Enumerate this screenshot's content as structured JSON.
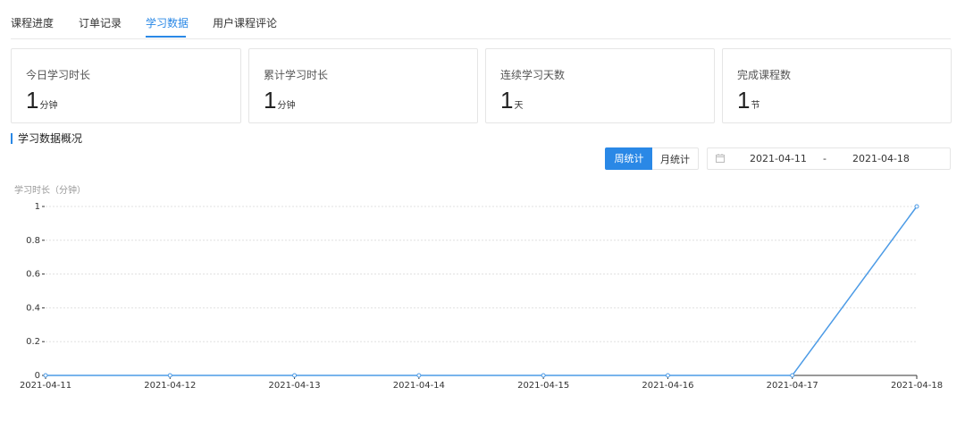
{
  "tabs": [
    {
      "label": "课程进度"
    },
    {
      "label": "订单记录"
    },
    {
      "label": "学习数据",
      "active": true
    },
    {
      "label": "用户课程评论"
    }
  ],
  "cards": [
    {
      "label": "今日学习时长",
      "value": "1",
      "unit": "分钟"
    },
    {
      "label": "累计学习时长",
      "value": "1",
      "unit": "分钟"
    },
    {
      "label": "连续学习天数",
      "value": "1",
      "unit": "天"
    },
    {
      "label": "完成课程数",
      "value": "1",
      "unit": "节"
    }
  ],
  "section": {
    "title": "学习数据概况"
  },
  "toggle": {
    "week_label": "周统计",
    "month_label": "月统计",
    "selected": "周统计"
  },
  "daterange": {
    "start": "2021-04-11",
    "separator": "-",
    "end": "2021-04-18",
    "icon": "calendar-icon"
  },
  "colors": {
    "accent": "#2a88e6",
    "line": "#4c9be6",
    "grid": "#e0e0e0"
  },
  "chart_data": {
    "type": "line",
    "ylabel": "学习时长（分钟）",
    "x": [
      "2021-04-11",
      "2021-04-12",
      "2021-04-13",
      "2021-04-14",
      "2021-04-15",
      "2021-04-16",
      "2021-04-17",
      "2021-04-18"
    ],
    "series": [
      {
        "values": [
          0,
          0,
          0,
          0,
          0,
          0,
          0,
          1
        ]
      }
    ],
    "yticks": [
      "0",
      "0.2",
      "0.4",
      "0.6",
      "0.8",
      "1"
    ],
    "ylim": [
      0,
      1
    ],
    "grid": "horizontal dotted",
    "legend": "none"
  }
}
